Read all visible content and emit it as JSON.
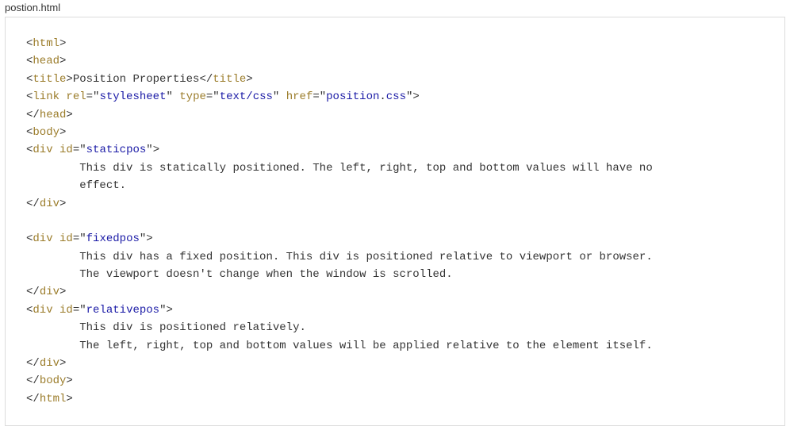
{
  "file": {
    "name": "postion.html"
  },
  "tok": {
    "lt": "<",
    "gt": ">",
    "lts": "</",
    "eq": "=",
    "q": "\"",
    "sp": " "
  },
  "tag": {
    "html": "html",
    "head": "head",
    "title": "title",
    "link": "link",
    "body": "body",
    "div": "div"
  },
  "attr": {
    "rel": "rel",
    "type": "type",
    "href": "href",
    "id": "id"
  },
  "val": {
    "stylesheet": "stylesheet",
    "textcss": "text/css",
    "href_pre": "position",
    "href_dot": ".",
    "href_ext": "css",
    "staticpos": "staticpos",
    "fixedpos": "fixedpos",
    "relativepos": "relativepos"
  },
  "text": {
    "title": "Position Properties",
    "static1": "        This div is statically positioned. The left, right, top and bottom values will have no",
    "static2": "        effect.",
    "fixed1": "        This div has a fixed position. This div is positioned relative to viewport or browser.",
    "fixed2": "        The viewport doesn't change when the window is scrolled.",
    "rel1": "        This div is positioned relatively.",
    "rel2": "        The left, right, top and bottom values will be applied relative to the element itself."
  }
}
